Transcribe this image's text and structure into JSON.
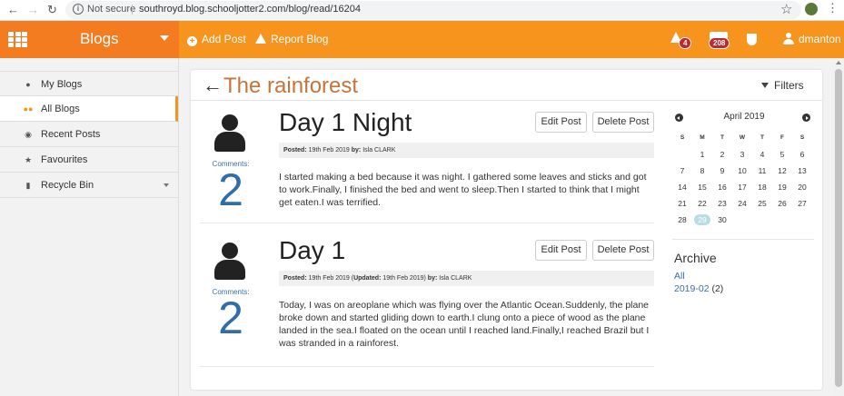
{
  "browser": {
    "url_security": "Not secure",
    "url": "southroyd.blog.schooljotter2.com/blog/read/16204"
  },
  "topnav": {
    "brand": "Blogs",
    "add_post": "Add Post",
    "report_blog": "Report Blog",
    "alerts_count": "4",
    "messages_count": "208",
    "username": "dmanton"
  },
  "sidebar": {
    "items": [
      {
        "label": "My Blogs",
        "icon": "user-icon"
      },
      {
        "label": "All Blogs",
        "icon": "users-icon",
        "active": true
      },
      {
        "label": "Recent Posts",
        "icon": "eye-icon"
      },
      {
        "label": "Favourites",
        "icon": "star-icon"
      },
      {
        "label": "Recycle Bin",
        "icon": "trash-icon"
      }
    ]
  },
  "main": {
    "title": "The rainforest",
    "filters": "Filters",
    "posts": [
      {
        "title": "Day 1 Night",
        "comments_label": "Comments:",
        "comments_count": "2",
        "edit": "Edit Post",
        "delete": "Delete Post",
        "meta_posted_label": "Posted:",
        "meta_posted": "19th Feb 2019",
        "meta_by_label": "by:",
        "meta_by": "Isla CLARK",
        "body": "I started making a bed because it was night. I gathered some leaves and sticks and got to work.Finally, I finished the bed and went to sleep.Then I started to think that I might get eaten.I was terrified."
      },
      {
        "title": "Day 1",
        "comments_label": "Comments:",
        "comments_count": "2",
        "edit": "Edit Post",
        "delete": "Delete Post",
        "meta_posted_label": "Posted:",
        "meta_posted": "19th Feb 2019",
        "meta_updated_label": "Updated:",
        "meta_updated": "19th Feb 2019",
        "meta_by_label": "by:",
        "meta_by": "Isla CLARK",
        "body": "Today, I was on areoplane which was flying over the Atlantic Ocean.Suddenly, the plane broke down and started gliding down to earth.I clung onto a piece of wood as the plane landed in the sea.I floated on the ocean until I reached land.Finally,I reached Brazil but I was stranded in a rainforest."
      }
    ]
  },
  "calendar": {
    "month": "April 2019",
    "days_of_week": [
      "S",
      "M",
      "T",
      "W",
      "T",
      "F",
      "S"
    ],
    "days": [
      "",
      "1",
      "2",
      "3",
      "4",
      "5",
      "6",
      "7",
      "8",
      "9",
      "10",
      "11",
      "12",
      "13",
      "14",
      "15",
      "16",
      "17",
      "18",
      "19",
      "20",
      "21",
      "22",
      "23",
      "24",
      "25",
      "26",
      "27",
      "28",
      "29",
      "30"
    ],
    "today": "29"
  },
  "archive": {
    "title": "Archive",
    "all": "All",
    "item_label": "2019-02",
    "item_count": "(2)"
  },
  "colors": {
    "nav_orange": "#f7941d",
    "brand_orange": "#f47c20",
    "title_color": "#c6743b",
    "link_blue": "#3a6fa5",
    "badge_red": "#c1272d"
  }
}
